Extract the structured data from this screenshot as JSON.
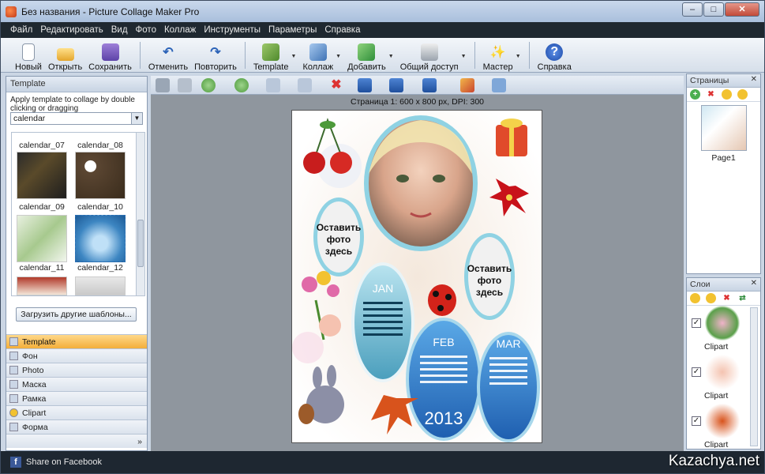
{
  "window": {
    "title": "Без названия - Picture Collage Maker Pro",
    "min": "–",
    "max": "□",
    "close": "✕"
  },
  "menu": [
    "Файл",
    "Редактировать",
    "Вид",
    "Фото",
    "Коллаж",
    "Инструменты",
    "Параметры",
    "Справка"
  ],
  "toolbar": {
    "new": "Новый",
    "open": "Открыть",
    "save": "Сохранить",
    "undo": "Отменить",
    "redo": "Повторить",
    "template": "Template",
    "collage": "Коллаж",
    "add": "Добавить",
    "share": "Общий доступ",
    "wizard": "Мастер",
    "help": "Справка"
  },
  "left": {
    "header": "Template",
    "hint": "Apply template to collage by double clicking or dragging",
    "category": "calendar",
    "thumbs": [
      "calendar_07",
      "calendar_08",
      "calendar_09",
      "calendar_10",
      "calendar_11",
      "calendar_12"
    ],
    "load_more": "Загрузить другие шаблоны...",
    "tabs": [
      "Template",
      "Фон",
      "Photo",
      "Маска",
      "Рамка",
      "Clipart",
      "Форма"
    ],
    "more": "»"
  },
  "center": {
    "page_info": "Страница 1: 600 x 800 px, DPI: 300",
    "placeholder": "Оставить фото здесь",
    "months": [
      "JAN",
      "FEB",
      "MAR"
    ],
    "year": "2013"
  },
  "pages_panel": {
    "header": "Страницы",
    "page_label": "Page1"
  },
  "layers_panel": {
    "header": "Слои",
    "layers": [
      "Clipart",
      "Clipart",
      "Clipart"
    ]
  },
  "status": {
    "share": "Share on Facebook"
  },
  "watermark": "Kazachya.net"
}
